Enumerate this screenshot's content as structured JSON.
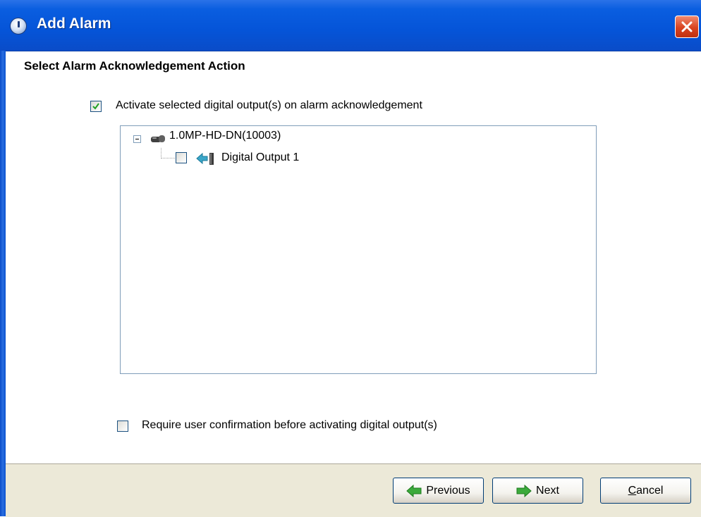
{
  "window": {
    "title": "Add Alarm"
  },
  "page": {
    "heading": "Select Alarm Acknowledgement Action"
  },
  "activate_option": {
    "label": "Activate selected digital output(s) on alarm acknowledgement",
    "checked": true
  },
  "tree": {
    "device": {
      "label": "1.0MP-HD-DN(10003)",
      "expanded": true,
      "icon": "camera-icon",
      "children": [
        {
          "label": "Digital Output 1",
          "checked": false,
          "icon": "digital-output-icon"
        }
      ]
    }
  },
  "confirm_option": {
    "label": "Require user confirmation before activating digital output(s)",
    "checked": false
  },
  "buttons": {
    "previous": "Previous",
    "next": "Next",
    "cancel_first": "C",
    "cancel_rest": "ancel"
  },
  "colors": {
    "titlebar": "#0554d8",
    "footer": "#ece9d8",
    "arrow_green": "#3caa3c",
    "close_red": "#d9431f"
  }
}
